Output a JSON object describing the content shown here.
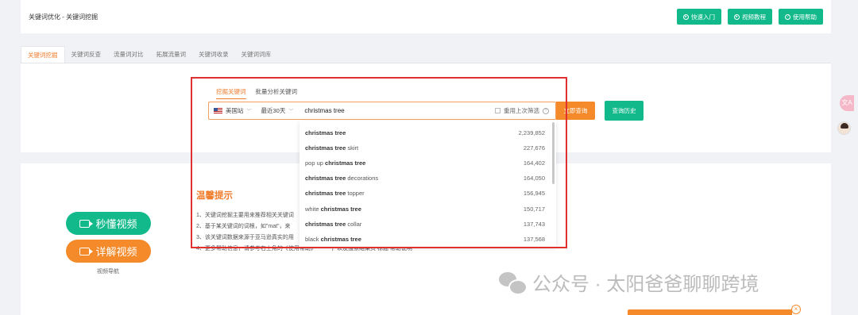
{
  "header": {
    "breadcrumb": "关键词优化 - 关键词挖掘",
    "buttons": [
      {
        "label": "快速入门"
      },
      {
        "label": "视频教程"
      },
      {
        "label": "使用帮助"
      }
    ]
  },
  "tabs": [
    "关键词挖掘",
    "关键词反查",
    "流量词对比",
    "拓展流量词",
    "关键词收录",
    "关键词词库"
  ],
  "subtabs": [
    "挖掘关键词",
    "批量分析关键词"
  ],
  "search": {
    "site": "美国站",
    "period": "最近30天",
    "keyword": "christmas tree",
    "reuse_label": "重用上次筛选",
    "search_button": "立即查询",
    "history_button": "查询历史"
  },
  "suggestions": [
    {
      "pre": "",
      "bold": "christmas tree",
      "post": "",
      "count": "2,239,852"
    },
    {
      "pre": "",
      "bold": "christmas tree",
      "post": " skirt",
      "count": "227,676"
    },
    {
      "pre": "pop up ",
      "bold": "christmas tree",
      "post": "",
      "count": "164,402"
    },
    {
      "pre": "",
      "bold": "christmas tree",
      "post": " decorations",
      "count": "164,050"
    },
    {
      "pre": "",
      "bold": "christmas tree",
      "post": " topper",
      "count": "156,945"
    },
    {
      "pre": "white ",
      "bold": "christmas tree",
      "post": "",
      "count": "150,717"
    },
    {
      "pre": "",
      "bold": "christmas tree",
      "post": " collar",
      "count": "137,743"
    },
    {
      "pre": "black ",
      "bold": "christmas tree",
      "post": "",
      "count": "137,568"
    }
  ],
  "tips": {
    "title": "温馨提示",
    "lines": [
      "1、关键词挖掘主要用来推荐相关关键词",
      "2、基于某关键词的词根，如\"mat\"，来",
      "3、该关键词数据来源于亚马逊真实的用",
      "4、更多帮助信息，请参考右上角的《使用帮助》"
    ],
    "line4_tail": "，以及搜索结果页 标题 帮助说明"
  },
  "videos": {
    "quick": "秒懂视频",
    "detail": "详解视频",
    "caption": "视频导航"
  },
  "watermark": "公众号 · 太阳爸爸聊聊跨境",
  "right_bubble": "文A",
  "colors": {
    "accent_orange": "#f48a2a",
    "accent_green": "#12b98a",
    "highlight_red": "#e03030"
  }
}
